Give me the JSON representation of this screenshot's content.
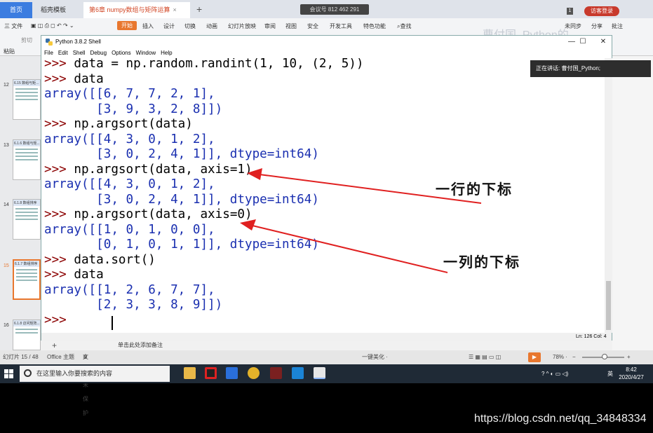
{
  "wps": {
    "tabs": {
      "home": "首页",
      "template": "稻壳模板",
      "doc": "第6章 numpy数组与矩阵运算",
      "doc_close": "×"
    },
    "meeting": "会议号 812 462 291",
    "visitor": "访客登录",
    "badge": "1",
    "menu": {
      "file": "三 文件",
      "start": "开始",
      "items": [
        "插入",
        "设计",
        "切换",
        "动画",
        "幻灯片放映",
        "审阅",
        "视图",
        "安全",
        "开发工具",
        "特色功能"
      ],
      "search": "查找",
      "paste": "粘贴",
      "cut": "剪切",
      "unsync": "未同步",
      "share": "分享",
      "annotate": "批注",
      "ghost": "曹付国_Python的"
    },
    "speaking": "正在讲话: 曹付国_Python;",
    "slides": [
      {
        "num": "12",
        "title": "6.15 数组与矩..."
      },
      {
        "num": "13",
        "title": "6.1.6 数组与矩..."
      },
      {
        "num": "14",
        "title": "6.1.8 数组排序"
      },
      {
        "num": "15",
        "title": "6.1.7 数组排序"
      },
      {
        "num": "16",
        "title": "6.1.8 访问矩阵..."
      }
    ],
    "notes_placeholder": "单击此处添加备注",
    "status": {
      "slide_count": "幻灯片 15 / 48",
      "theme": "Office 主题",
      "protect": "文档未保护",
      "beautify": "一键美化 ·",
      "zoom": "78% ·"
    }
  },
  "idle": {
    "title": "Python 3.8.2 Shell",
    "menu": [
      "File",
      "Edit",
      "Shell",
      "Debug",
      "Options",
      "Window",
      "Help"
    ],
    "lines": [
      {
        "prompt": ">>> ",
        "text": "data = np.random.randint(1, 10, (2, 5))"
      },
      {
        "prompt": ">>> ",
        "text": "data"
      },
      {
        "out": "array([[6, 7, 7, 2, 1],"
      },
      {
        "out": "       [3, 9, 3, 2, 8]])"
      },
      {
        "prompt": ">>> ",
        "text": "np.argsort(data)"
      },
      {
        "out": "array([[4, 3, 0, 1, 2],"
      },
      {
        "out": "       [3, 0, 2, 4, 1]], dtype=int64)"
      },
      {
        "prompt": ">>> ",
        "text": "np.argsort(data, axis=1)"
      },
      {
        "out": "array([[4, 3, 0, 1, 2],"
      },
      {
        "out": "       [3, 0, 2, 4, 1]], dtype=int64)"
      },
      {
        "prompt": ">>> ",
        "text": "np.argsort(data, axis=0)"
      },
      {
        "out": "array([[1, 0, 1, 0, 0],"
      },
      {
        "out": "       [0, 1, 0, 1, 1]], dtype=int64)"
      },
      {
        "prompt": ">>> ",
        "text": "data.sort()"
      },
      {
        "prompt": ">>> ",
        "text": "data"
      },
      {
        "out": "array([[1, 2, 6, 7, 7],"
      },
      {
        "out": "       [2, 3, 3, 8, 9]])"
      },
      {
        "prompt": ">>> ",
        "text": ""
      }
    ],
    "status": "Ln: 126  Col: 4"
  },
  "annotations": {
    "row": "一行的下标",
    "col": "一列的下标",
    "arrow_color": "#e02020"
  },
  "taskbar": {
    "search_placeholder": "在这里输入你要搜索的内容",
    "ime": "英",
    "time": "8:42",
    "date": "2020/4/27"
  },
  "watermark": "https://blog.csdn.net/qq_34848334"
}
